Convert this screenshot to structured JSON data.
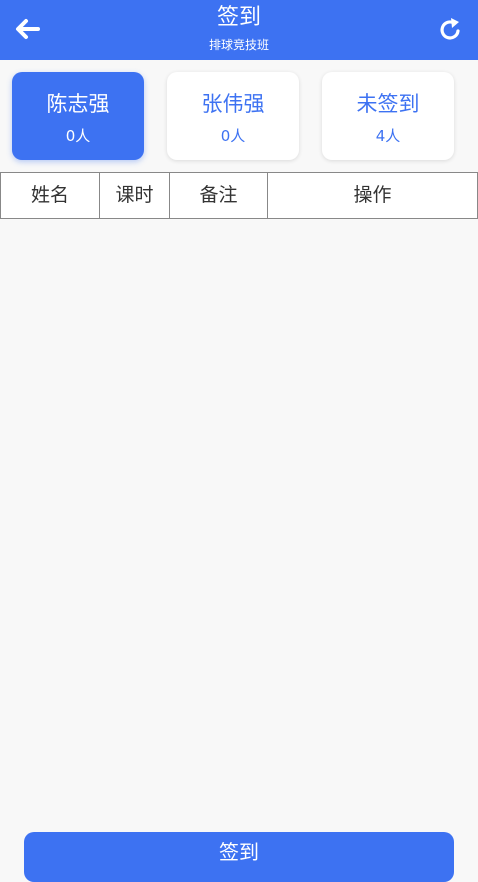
{
  "header": {
    "title": "签到",
    "subtitle": "排球竞技班"
  },
  "cards": [
    {
      "name": "陈志强",
      "count": "0人",
      "active": true
    },
    {
      "name": "张伟强",
      "count": "0人",
      "active": false
    },
    {
      "name": "未签到",
      "count": "4人",
      "active": false
    }
  ],
  "table": {
    "columns": [
      "姓名",
      "课时",
      "备注",
      "操作"
    ]
  },
  "bottom_button": {
    "label": "签到"
  },
  "colors": {
    "primary": "#3d72f2",
    "background": "#f8f8f8"
  }
}
